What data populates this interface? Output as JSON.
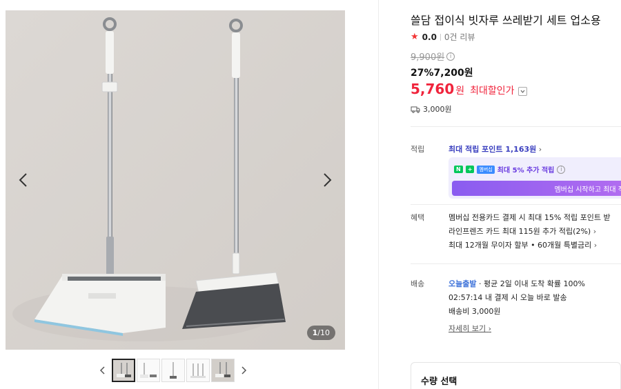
{
  "gallery": {
    "counter_current": "1",
    "counter_total": "/10"
  },
  "product": {
    "title": "쓸담 접이식 빗자루 쓰레받기 세트 업소용",
    "rating_score": "0.0",
    "review_count": "0건 리뷰",
    "original_price": "9,900원",
    "discount_line": "27%7,200원",
    "max_discount_price": "5,760",
    "max_discount_won": "원",
    "max_discount_label": "최대할인가",
    "shipping_fee": "3,000원"
  },
  "points": {
    "label": "적립",
    "max_points": "최대 적립 포인트 1,163원",
    "member_text": "최대 5% 추가 적립",
    "badge_n": "N",
    "badge_plus": "+",
    "badge_membership": "멤버십",
    "member_button": "멤버십 시작하고 최대 적"
  },
  "benefits": {
    "label": "혜택",
    "line1": "멤버십 전용카드 결제 시 최대 15% 적립 포인트 받",
    "line2": "라인프렌즈 카드 최대 115원 추가 적립(2%)",
    "line3": "최대 12개월 무이자 할부 • 60개월 특별금리"
  },
  "delivery": {
    "label": "배송",
    "today_label": "오늘출발",
    "line1_rest": "· 평균 2일 이내 도착 확률 100%",
    "line2": "02:57:14  내 결제 시 오늘 바로 발송",
    "line3": "배송비 3,000원",
    "details_link": "자세히 보기"
  },
  "quantity": {
    "label": "수량 선택"
  },
  "colors": {
    "sale_red": "#f0243c",
    "point_blue": "#3a3fbf",
    "membership_purple": "#8a5cf0",
    "naver_green": "#03c75a"
  }
}
